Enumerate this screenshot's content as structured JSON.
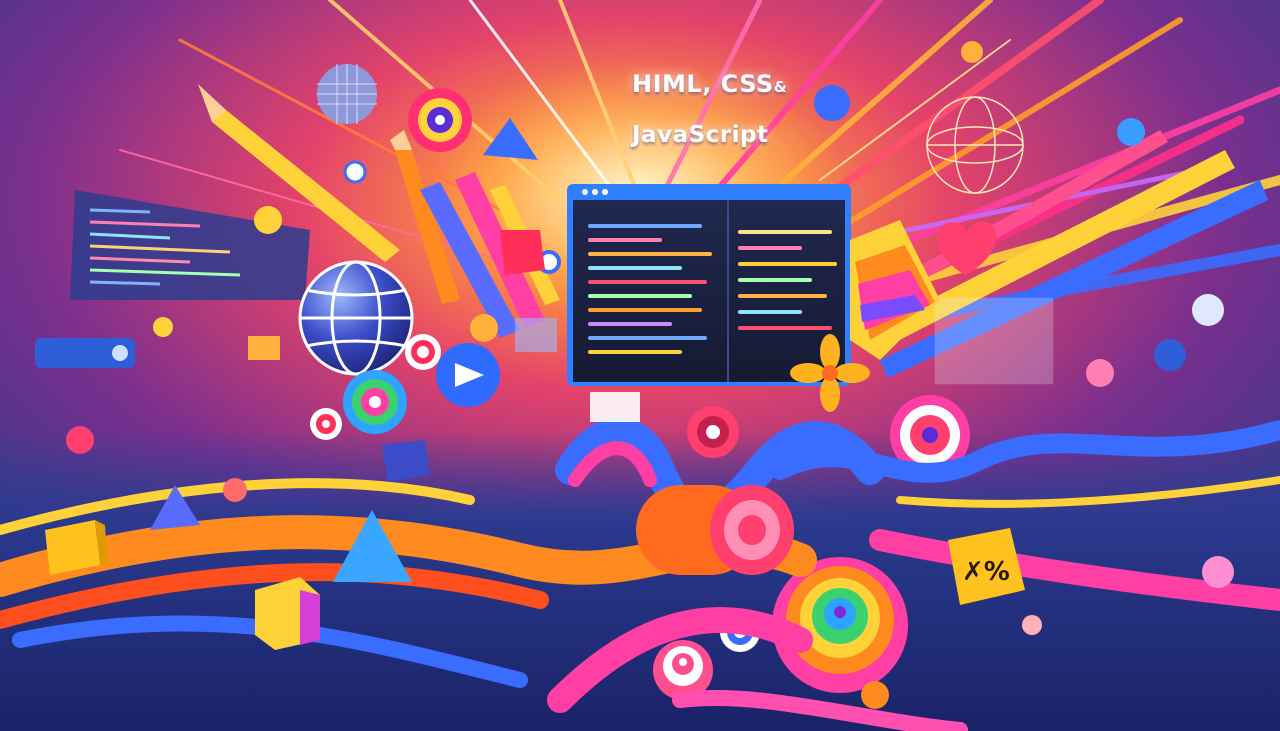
{
  "title": {
    "line1_main": "HIML, CSS",
    "line1_amp": "&",
    "line2": "JavaScript"
  },
  "colors": {
    "background": "#1b1f4a",
    "glow": "#ffd27a",
    "accent_pink": "#ff3fa4",
    "accent_orange": "#ff8a1f",
    "accent_blue": "#3a6cff",
    "accent_yellow": "#ffd23a"
  },
  "icons": [
    "globe-icon",
    "heart-icon",
    "pencil-icon",
    "cube-icon",
    "triangle-icon",
    "target-icon",
    "code-editor-window",
    "disco-ball-icon",
    "wire-sphere-icon",
    "flower-icon",
    "play-badge-icon"
  ]
}
